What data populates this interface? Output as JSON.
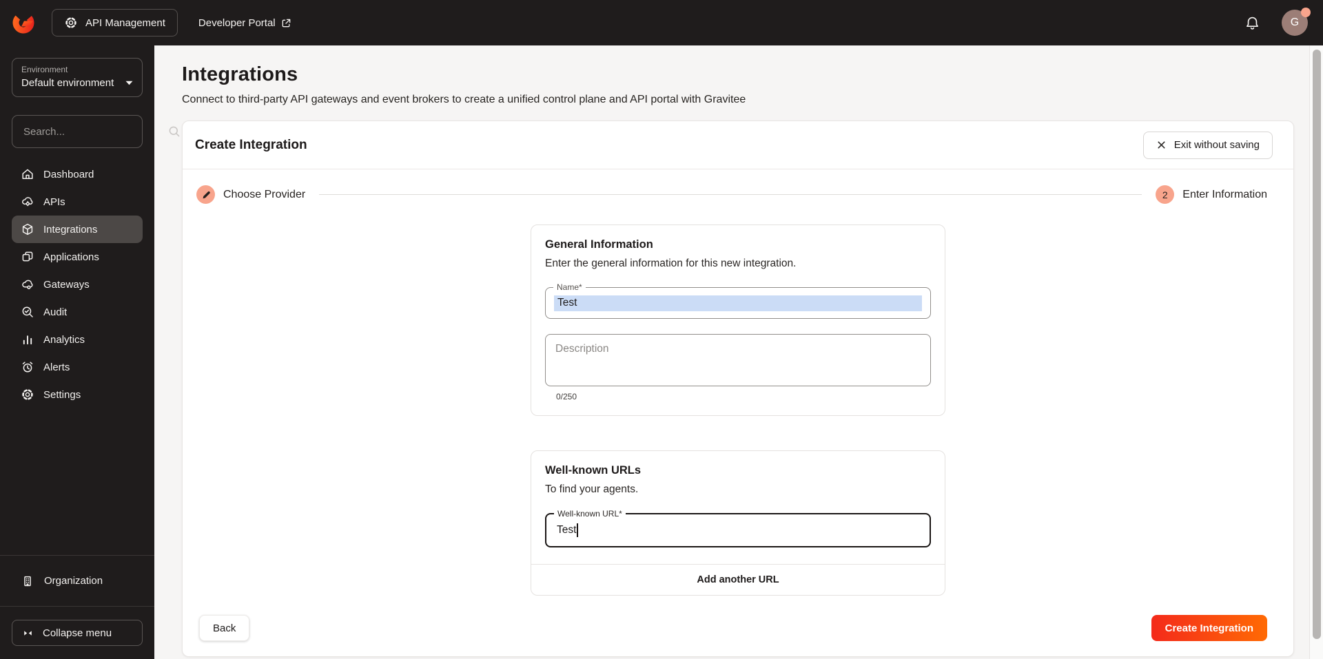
{
  "topbar": {
    "app_switcher_label": "API Management",
    "developer_portal_label": "Developer Portal",
    "avatar_initial": "G"
  },
  "sidebar": {
    "environment_label": "Environment",
    "environment_value": "Default environment",
    "search_placeholder": "Search...",
    "items": [
      {
        "label": "Dashboard",
        "icon": "home-icon",
        "active": false
      },
      {
        "label": "APIs",
        "icon": "cloud-gear-icon",
        "active": false
      },
      {
        "label": "Integrations",
        "icon": "cube-icon",
        "active": true
      },
      {
        "label": "Applications",
        "icon": "stacked-windows-icon",
        "active": false
      },
      {
        "label": "Gateways",
        "icon": "cloud-node-icon",
        "active": false
      },
      {
        "label": "Audit",
        "icon": "search-check-icon",
        "active": false
      },
      {
        "label": "Analytics",
        "icon": "bar-chart-icon",
        "active": false
      },
      {
        "label": "Alerts",
        "icon": "alarm-clock-icon",
        "active": false
      },
      {
        "label": "Settings",
        "icon": "gear-icon",
        "active": false
      }
    ],
    "organization_label": "Organization",
    "collapse_label": "Collapse menu"
  },
  "page": {
    "title": "Integrations",
    "subtitle": "Connect to third-party API gateways and event brokers to create a unified control plane and API portal with Gravitee"
  },
  "wizard": {
    "title": "Create Integration",
    "exit_button": "Exit without saving",
    "steps": [
      {
        "label": "Choose Provider",
        "indicator": "pencil-icon"
      },
      {
        "label": "Enter Information",
        "indicator": "2"
      }
    ],
    "general": {
      "title": "General Information",
      "subtitle": "Enter the general information for this new integration.",
      "name_label": "Name*",
      "name_value": "Test",
      "description_placeholder": "Description",
      "char_counter": "0/250"
    },
    "wellknown": {
      "title": "Well-known URLs",
      "subtitle": "To find your agents.",
      "url_label": "Well-known URL*",
      "url_value": "Test",
      "add_button": "Add another URL"
    },
    "back_button": "Back",
    "submit_button": "Create Integration"
  },
  "colors": {
    "topbar_bg": "#1f1c1c",
    "accent_salmon": "#f8a48c",
    "selection_highlight": "#cbdcf6",
    "submit_gradient_start": "#f42a1b",
    "submit_gradient_end": "#ff6a04",
    "avatar_bg": "#9c7e77"
  }
}
